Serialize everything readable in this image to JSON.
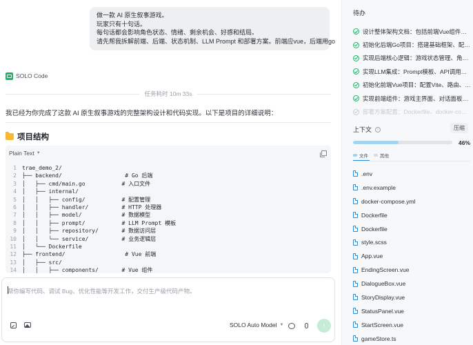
{
  "chat": {
    "user_message": [
      "做一款 AI 原生叙事游戏。",
      "玩家只有十句话。",
      "每句话都会影响角色状态、情绪、剩余机会、好感和结局。",
      "请先帮我拆解前端、后端、状态机制、LLM Prompt 和部署方案。前端应vue，后端用go"
    ],
    "agent_name": "SOLO Code",
    "task_time": "任务耗时 10m 33s",
    "intro": "我已经为你完成了这款 AI 原生叙事游戏的完整架构设计和代码实现。以下是项目的详细说明：",
    "section_title": "项目结构",
    "code_block": {
      "language": "Plain Text",
      "lines": [
        {
          "n": "1",
          "text": "trae_demo_2/"
        },
        {
          "n": "2",
          "text": "├── backend/                   # Go 后端"
        },
        {
          "n": "3",
          "text": "│   ├── cmd/main.go           # 入口文件"
        },
        {
          "n": "4",
          "text": "│   ├── internal/"
        },
        {
          "n": "5",
          "text": "│   │   ├── config/           # 配置管理"
        },
        {
          "n": "6",
          "text": "│   │   ├── handler/          # HTTP 处理器"
        },
        {
          "n": "7",
          "text": "│   │   ├── model/            # 数据模型"
        },
        {
          "n": "8",
          "text": "│   │   ├── prompt/           # LLM Prompt 模板"
        },
        {
          "n": "9",
          "text": "│   │   ├── repository/       # 数据访问层"
        },
        {
          "n": "10",
          "text": "│   │   └── service/          # 业务逻辑层"
        },
        {
          "n": "11",
          "text": "│   └── Dockerfile"
        },
        {
          "n": "12",
          "text": "├── frontend/                  # Vue 前端"
        },
        {
          "n": "13",
          "text": "│   ├── src/"
        },
        {
          "n": "14",
          "text": "│   │   ├── components/       # Vue 组件"
        }
      ]
    },
    "input_placeholder": "帮你编写代码、调试 Bug、优化性能等开发工作，交付生产级代码产物。",
    "model_label": "SOLO Auto Model"
  },
  "sidebar": {
    "todo_title": "待办",
    "todos": [
      {
        "text": "设计整体架构文档：包括前端Vue组件、…",
        "faded": false
      },
      {
        "text": "初始化后端Go项目：搭建基础框架、配置…",
        "faded": false
      },
      {
        "text": "实现后端核心逻辑：游戏状态管理、角色…",
        "faded": false
      },
      {
        "text": "实现LLM集成：Prompt模板、API调用、…",
        "faded": false
      },
      {
        "text": "初始化前端Vue项目：配置Vite、路由、…",
        "faded": false
      },
      {
        "text": "实现前端组件：游戏主界面、对话面板、…",
        "faded": false
      },
      {
        "text": "部署方案配置：Dockerfile、docker-comp…",
        "faded": true
      }
    ],
    "context_title": "上下文",
    "compress_label": "压缩",
    "context_percent": 46,
    "context_percent_label": "46%",
    "legend": [
      {
        "label": "文件",
        "color": "#a5d4f2"
      },
      {
        "label": "其他",
        "color": "#d9dce0"
      }
    ],
    "files": [
      ".env",
      ".env.example",
      "docker-compose.yml",
      "Dockerfile",
      "Dockerfile",
      "style.scss",
      "App.vue",
      "EndingScreen.vue",
      "DialogueBox.vue",
      "StoryDisplay.vue",
      "StatusPanel.vue",
      "StartScreen.vue",
      "gameStore.ts"
    ],
    "accent_color": "#20b26b"
  }
}
